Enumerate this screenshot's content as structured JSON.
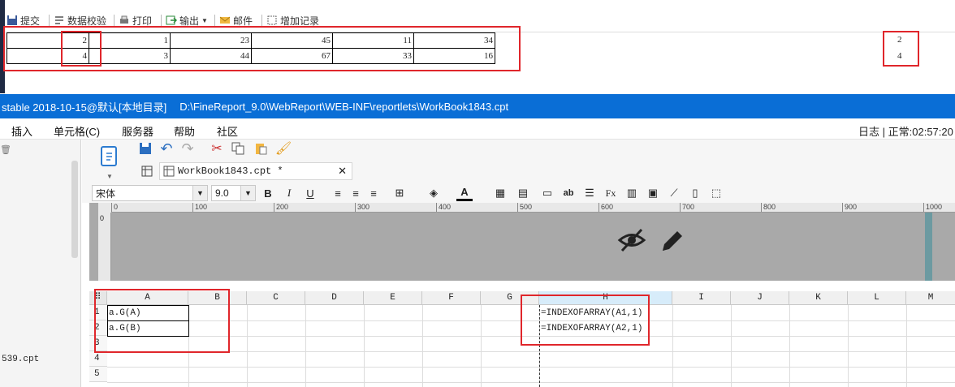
{
  "preview": {
    "toolbar": [
      {
        "label": "提交"
      },
      {
        "label": "数据校验"
      },
      {
        "label": "打印"
      },
      {
        "label": "输出"
      },
      {
        "label": "邮件"
      },
      {
        "label": "增加记录"
      }
    ],
    "table": [
      [
        "2",
        "1",
        "23",
        "45",
        "11",
        "34"
      ],
      [
        "4",
        "3",
        "44",
        "67",
        "33",
        "16"
      ]
    ],
    "side_values": [
      "2",
      "4"
    ]
  },
  "titlebar": {
    "left": "stable 2018-10-15@默认[本地目录]",
    "path": "D:\\FineReport_9.0\\WebReport\\WEB-INF\\reportlets\\WorkBook1843.cpt"
  },
  "menu": {
    "items": [
      "插入",
      "单元格(C)",
      "服务器",
      "帮助",
      "社区"
    ],
    "log": "日志",
    "status": "正常:02:57:20"
  },
  "left_panel": {
    "file": "539.cpt"
  },
  "editor": {
    "file_tab": "WorkBook1843.cpt *",
    "font_name": "宋体",
    "font_size": "9.0",
    "ruler_labels": [
      "0",
      "100",
      "200",
      "300",
      "400",
      "500",
      "600",
      "700",
      "800",
      "900",
      "1000"
    ]
  },
  "sheet": {
    "columns": [
      "A",
      "B",
      "C",
      "D",
      "E",
      "F",
      "G",
      "H",
      "I",
      "J",
      "K",
      "L",
      "M"
    ],
    "rows": [
      "1",
      "2",
      "3",
      "4",
      "5"
    ],
    "cells": {
      "A1": "a.G(A)",
      "A2": "a.G(B)",
      "H1": "=INDEXOFARRAY(A1,1)",
      "H2": "=INDEXOFARRAY(A2,1)"
    }
  },
  "colors": {
    "titlebar": "#0a6ed6",
    "highlight": "#e0262b",
    "teal": "#6c9aa1"
  }
}
